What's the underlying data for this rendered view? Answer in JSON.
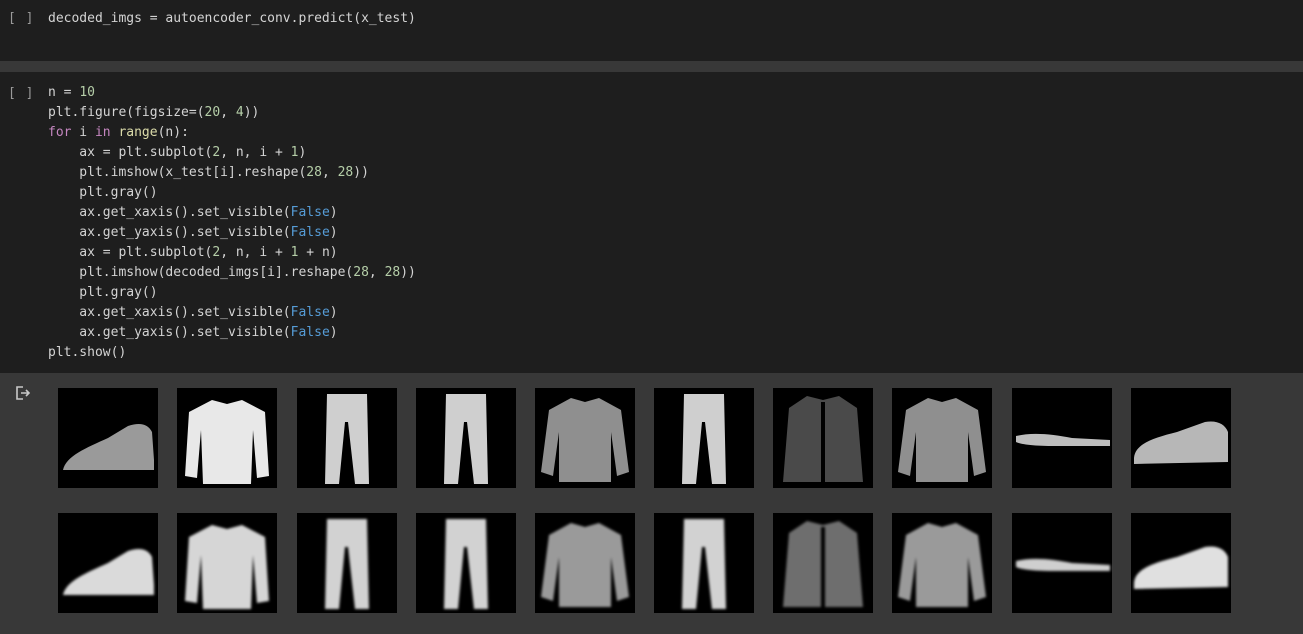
{
  "cells": [
    {
      "run_label": "[ ]",
      "lines": [
        [
          [
            "t",
            "decoded_imgs = autoencoder_conv.predict(x_test)"
          ]
        ]
      ]
    },
    {
      "run_label": "[ ]",
      "lines": [
        [
          [
            "t",
            "n = "
          ],
          [
            "n",
            "10"
          ]
        ],
        [
          [
            "t",
            "plt.figure(figsize=("
          ],
          [
            "n",
            "20"
          ],
          [
            "t",
            ", "
          ],
          [
            "n",
            "4"
          ],
          [
            "t",
            "))"
          ]
        ],
        [
          [
            "k",
            "for"
          ],
          [
            "t",
            " i "
          ],
          [
            "k",
            "in"
          ],
          [
            "t",
            " "
          ],
          [
            "b",
            "range"
          ],
          [
            "t",
            "(n):"
          ]
        ],
        [
          [
            "t",
            "    ax = plt.subplot("
          ],
          [
            "n",
            "2"
          ],
          [
            "t",
            ", n, i + "
          ],
          [
            "n",
            "1"
          ],
          [
            "t",
            ")"
          ]
        ],
        [
          [
            "t",
            "    plt.imshow(x_test[i].reshape("
          ],
          [
            "n",
            "28"
          ],
          [
            "t",
            ", "
          ],
          [
            "n",
            "28"
          ],
          [
            "t",
            "))"
          ]
        ],
        [
          [
            "t",
            "    plt.gray()"
          ]
        ],
        [
          [
            "t",
            "    ax.get_xaxis().set_visible("
          ],
          [
            "c",
            "False"
          ],
          [
            "t",
            ")"
          ]
        ],
        [
          [
            "t",
            "    ax.get_yaxis().set_visible("
          ],
          [
            "c",
            "False"
          ],
          [
            "t",
            ")"
          ]
        ],
        [
          [
            "t",
            "    ax = plt.subplot("
          ],
          [
            "n",
            "2"
          ],
          [
            "t",
            ", n, i + "
          ],
          [
            "n",
            "1"
          ],
          [
            "t",
            " + n)"
          ]
        ],
        [
          [
            "t",
            "    plt.imshow(decoded_imgs[i].reshape("
          ],
          [
            "n",
            "28"
          ],
          [
            "t",
            ", "
          ],
          [
            "n",
            "28"
          ],
          [
            "t",
            "))"
          ]
        ],
        [
          [
            "t",
            "    plt.gray()"
          ]
        ],
        [
          [
            "t",
            "    ax.get_xaxis().set_visible("
          ],
          [
            "c",
            "False"
          ],
          [
            "t",
            ")"
          ]
        ],
        [
          [
            "t",
            "    ax.get_yaxis().set_visible("
          ],
          [
            "c",
            "False"
          ],
          [
            "t",
            ")"
          ]
        ],
        [
          [
            "t",
            "plt.show()"
          ]
        ]
      ]
    }
  ],
  "output": {
    "icon": "output-exit-icon",
    "originals": [
      "ankle-boot",
      "pullover",
      "trouser",
      "trouser",
      "shirt",
      "trouser",
      "coat",
      "shirt",
      "sandal",
      "sneaker"
    ],
    "reconstructions": [
      "ankle-boot",
      "pullover",
      "trouser",
      "trouser",
      "shirt",
      "trouser",
      "coat",
      "shirt",
      "sandal",
      "sneaker"
    ]
  }
}
